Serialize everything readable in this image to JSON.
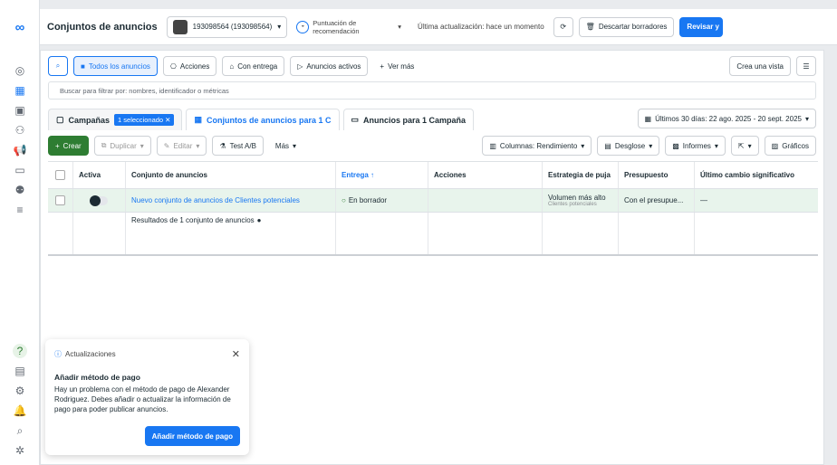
{
  "brand": {
    "logo": "∞"
  },
  "topbar": {
    "title": "Conjuntos de anuncios",
    "account": "193098564 (193098564)",
    "score_label": "Puntuación de recomendación",
    "last_update": "Última actualización: hace un momento",
    "discard": "Descartar borradores",
    "review": "Revisar y"
  },
  "row1": {
    "all_ads": "Todos los anuncios",
    "actions": "Acciones",
    "with_delivery": "Con entrega",
    "active_ads": "Anuncios activos",
    "more": "Ver más",
    "create_view": "Crea una vista"
  },
  "filter": {
    "placeholder": "Buscar para filtrar por: nombres, identificador o métricas"
  },
  "tabs": {
    "campaigns": "Campañas",
    "selected_chip": "1 seleccionado",
    "adsets": "Conjuntos de anuncios para 1 C",
    "ads": "Anuncios para 1 Campaña",
    "date_range": "Últimos 30 días: 22 ago. 2025 - 20 sept. 2025"
  },
  "toolbar": {
    "create": "Crear",
    "duplicate": "Duplicar",
    "edit": "Editar",
    "test": "Test A/B",
    "more": "Más",
    "columns": "Columnas: Rendimiento",
    "breakdown": "Desglose",
    "reports": "Informes",
    "charts": "Gráficos"
  },
  "table": {
    "headers": [
      "Activa",
      "Conjunto de anuncios",
      "Entrega ↑",
      "Acciones",
      "Estrategia de puja",
      "Presupuesto",
      "Último cambio significativo"
    ],
    "row": {
      "name": "Nuevo conjunto de anuncios de Clientes potenciales",
      "delivery": "En borrador",
      "strategy": "Volumen más alto",
      "strategy_sub": "Clientes potenciales",
      "budget": "Con el presupue...",
      "last_change": "—"
    },
    "summary": "Resultados de 1 conjunto de anuncios"
  },
  "notification": {
    "header": "Actualizaciones",
    "title": "Añadir método de pago",
    "body": "Hay un problema con el método de pago de Alexander Rodriguez. Debes añadir o actualizar la información de pago para poder publicar anuncios.",
    "action": "Añadir método de pago"
  }
}
